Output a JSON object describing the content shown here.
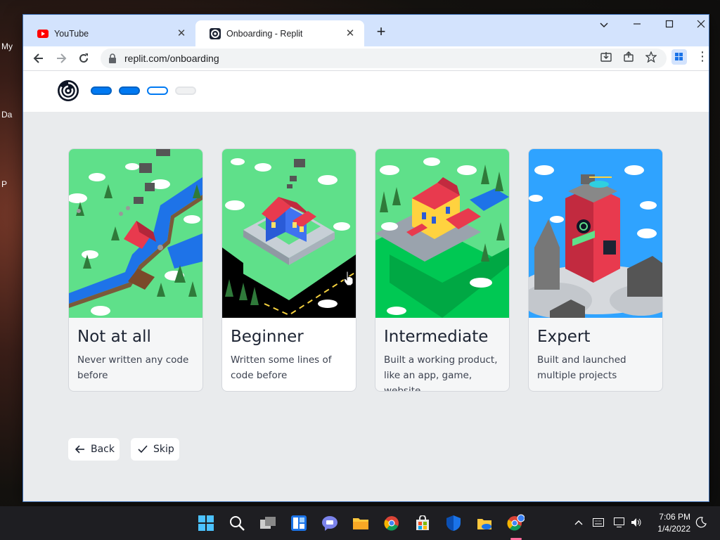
{
  "desktop": {
    "icon_labels": [
      "My",
      "Da",
      "P"
    ]
  },
  "browser": {
    "tabs": [
      {
        "title": "YouTube",
        "favicon": "youtube-icon",
        "active": false
      },
      {
        "title": "Onboarding - Replit",
        "favicon": "replit-icon",
        "active": true
      }
    ],
    "new_tab_label": "+",
    "url": "replit.com/onboarding",
    "colors": {
      "tabstrip": "#d3e3fd",
      "accent": "#0079f2"
    }
  },
  "onboarding": {
    "progress_steps": [
      "filled",
      "filled",
      "current",
      "empty"
    ],
    "cards": [
      {
        "title": "Not at all",
        "description": "Never written any code before",
        "illustration": "campsite-scene"
      },
      {
        "title": "Beginner",
        "description": "Written some lines of code before",
        "illustration": "house-scene"
      },
      {
        "title": "Intermediate",
        "description": "Built a working product, like an app, game, website",
        "illustration": "mansion-scene"
      },
      {
        "title": "Expert",
        "description": "Built and launched multiple projects",
        "illustration": "replit-tower-scene"
      }
    ],
    "back_label": "Back",
    "skip_label": "Skip"
  },
  "taskbar": {
    "apps": [
      "start-icon",
      "search-icon",
      "task-view-icon",
      "widgets-icon",
      "teams-chat-icon",
      "file-explorer-icon",
      "chrome-icon",
      "store-icon",
      "defender-icon",
      "onedrive-icon",
      "chrome-active-icon"
    ],
    "time": "7:06 PM",
    "date": "1/4/2022"
  }
}
